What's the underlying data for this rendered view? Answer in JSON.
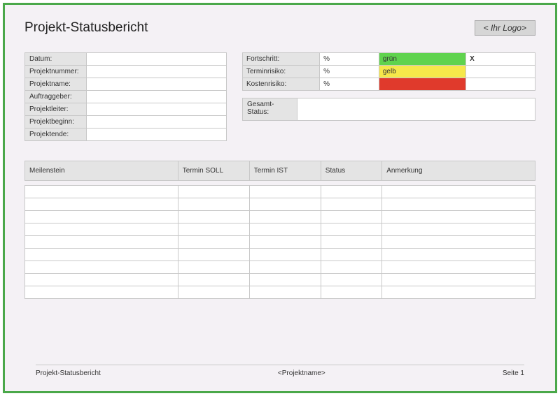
{
  "title": "Projekt-Statusbericht",
  "logo_placeholder": "< Ihr Logo>",
  "info_fields": {
    "datum": {
      "label": "Datum:",
      "value": ""
    },
    "projektnummer": {
      "label": "Projektnummer:",
      "value": ""
    },
    "projektname": {
      "label": "Projektname:",
      "value": ""
    },
    "auftraggeber": {
      "label": "Auftraggeber:",
      "value": ""
    },
    "projektleiter": {
      "label": "Projektleiter:",
      "value": ""
    },
    "projektbeginn": {
      "label": "Projektbeginn:",
      "value": ""
    },
    "projektende": {
      "label": "Projektende:",
      "value": ""
    }
  },
  "risk": {
    "fortschritt": {
      "label": "Fortschritt:",
      "unit": "%",
      "color_label": "grün",
      "mark": "X"
    },
    "terminrisiko": {
      "label": "Terminrisiko:",
      "unit": "%",
      "color_label": "gelb",
      "mark": ""
    },
    "kostenrisiko": {
      "label": "Kostenrisiko:",
      "unit": "%",
      "color_label": "rot",
      "mark": ""
    }
  },
  "overall": {
    "label": "Gesamt-Status:",
    "value": ""
  },
  "milestone_headers": {
    "meilenstein": "Meilenstein",
    "termin_soll": "Termin SOLL",
    "termin_ist": "Termin IST",
    "status": "Status",
    "anmerkung": "Anmerkung"
  },
  "milestone_row_count": 9,
  "footer": {
    "left": "Projekt-Statusbericht",
    "center": "<Projektname>",
    "right": "Seite 1"
  },
  "colors": {
    "frame_border": "#4aa84a",
    "page_bg": "#f4f1f5",
    "cell_bg": "#e4e4e4",
    "green": "#5fd34e",
    "yellow": "#f6e84a",
    "red": "#e03a2c"
  }
}
